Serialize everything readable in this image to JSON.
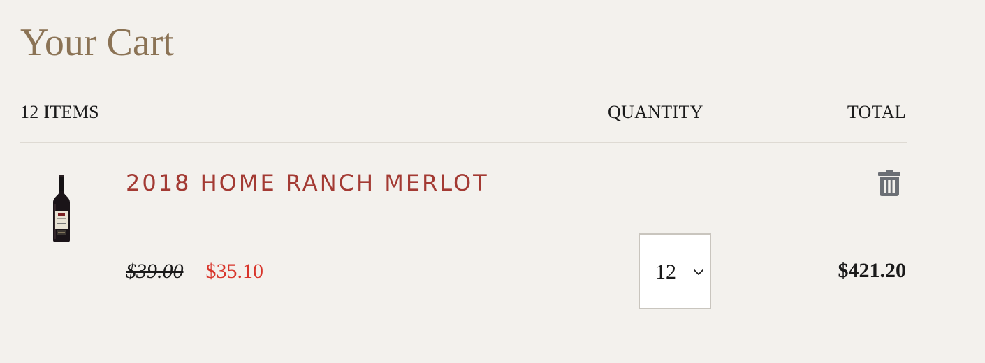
{
  "cart": {
    "title": "Your Cart",
    "items_count_label": "12 ITEMS",
    "quantity_header": "QUANTITY",
    "total_header": "TOTAL"
  },
  "items": [
    {
      "name": "2018 HOME RANCH MERLOT",
      "original_price": "$39.00",
      "sale_price": "$35.10",
      "quantity": "12",
      "line_total": "$421.20",
      "image_icon": "wine-bottle-icon",
      "remove_icon": "trash-icon"
    }
  ],
  "colors": {
    "background": "#f3f1ed",
    "title": "#8b7355",
    "product_name": "#a33a33",
    "sale_price": "#d8342a",
    "divider": "#dedad3",
    "icon": "#6b6f75"
  }
}
